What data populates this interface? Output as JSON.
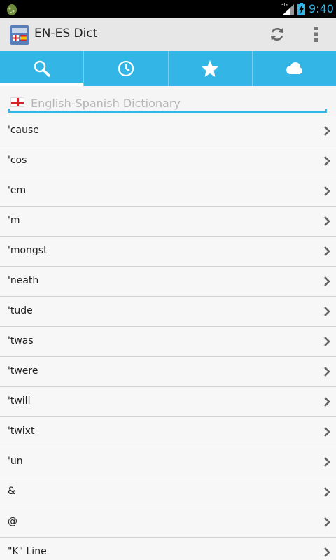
{
  "status_bar": {
    "network_label": "3G",
    "time": "9:40",
    "accent": "#33b5e5"
  },
  "action_bar": {
    "title": "EN-ES Dict",
    "icons": [
      "app-dictionary-icon",
      "refresh-icon",
      "overflow-menu-icon"
    ]
  },
  "tabs": [
    {
      "icon": "search-icon",
      "active": true
    },
    {
      "icon": "history-clock-icon",
      "active": false
    },
    {
      "icon": "favorites-star-icon",
      "active": false
    },
    {
      "icon": "cloud-icon",
      "active": false
    }
  ],
  "search": {
    "placeholder": "English-Spanish Dictionary",
    "value": "",
    "flag_icon": "english-flag-icon"
  },
  "words": [
    "'cause",
    "'cos",
    "'em",
    "'m",
    "'mongst",
    "'neath",
    "'tude",
    "'twas",
    "'twere",
    "'twill",
    "'twixt",
    "'un",
    "&",
    "@",
    "\"K\" Line"
  ],
  "colors": {
    "accent": "#33b5e5",
    "action_bar": "#e7e7e7",
    "list_background": "#f7f7f7"
  }
}
